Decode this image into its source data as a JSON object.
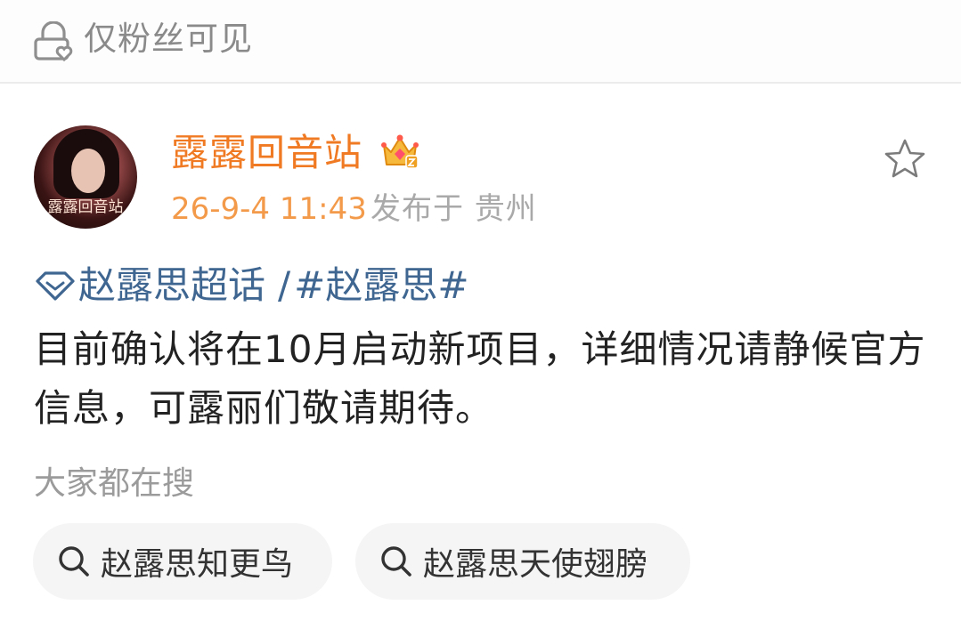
{
  "visibility": {
    "label": "仅粉丝可见",
    "icon": "lock-heart-icon"
  },
  "post": {
    "author": {
      "name": "露露回音站",
      "avatar_caption": "露露回音站",
      "badge_icon": "crown-badge-icon"
    },
    "time": "26-9-4 11:43",
    "location": "发布于 贵州",
    "favorite_icon": "star-outline-icon",
    "topic": {
      "supertopic": "赵露思超话",
      "separator": "/",
      "hashtag": "#赵露思#"
    },
    "body": "目前确认将在10月启动新项目，详细情况请静候官方信息，可露丽们敬请期待。"
  },
  "related_search": {
    "heading": "大家都在搜",
    "items": [
      {
        "label": "赵露思知更鸟"
      },
      {
        "label": "赵露思天使翅膀"
      }
    ]
  },
  "colors": {
    "author_name": "#f07a23",
    "time": "#f39a4a",
    "topic_link": "#3f6690",
    "body_text": "#222222",
    "muted": "#9b9b9b"
  }
}
